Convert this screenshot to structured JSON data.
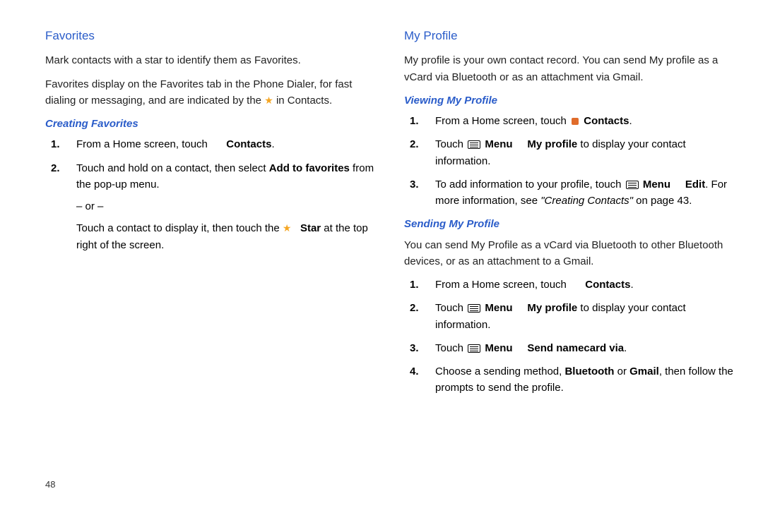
{
  "pageNumber": "48",
  "left": {
    "h1": "Favorites",
    "p1": "Mark contacts with a star to identify them as Favorites.",
    "p2a": "Favorites display on the Favorites tab in the Phone Dialer, for fast dialing or messaging, and are indicated by the ",
    "p2b": " in Contacts.",
    "h2": "Creating Favorites",
    "s1_num": "1.",
    "s1_a": "From a Home screen, touch ",
    "s1_b": "Contacts",
    "s1_c": ".",
    "s2_num": "2.",
    "s2_a": "Touch and hold on a contact, then select ",
    "s2_b": "Add to favorites",
    "s2_c": " from the pop-up menu.",
    "s2_or": "– or –",
    "s2_d": "Touch a contact to display it, then touch the ",
    "s2_e": "Star",
    "s2_f": " at the top right of the screen."
  },
  "right": {
    "h1": "My Profile",
    "p1": "My profile is your own contact record. You can send My profile as a vCard via Bluetooth or as an attachment via Gmail.",
    "h2a": "Viewing My Profile",
    "a1_num": "1.",
    "a1_a": "From a Home screen, touch ",
    "a1_b": "Contacts",
    "a1_c": ".",
    "a2_num": "2.",
    "a2_a": "Touch ",
    "a2_b": "Menu",
    "a2_arrow": " ",
    "a2_c": "My profile",
    "a2_d": " to display your contact information.",
    "a3_num": "3.",
    "a3_a": "To add information to your profile, touch ",
    "a3_b": "Menu",
    "a3_c": "Edit",
    "a3_d": ". For more information, see ",
    "a3_e": "\"Creating Contacts\"",
    "a3_f": " on page 43.",
    "h2b": "Sending My Profile",
    "p2": "You can send My Profile as a vCard via Bluetooth to other Bluetooth devices, or as an attachment to a Gmail.",
    "b1_num": "1.",
    "b1_a": "From a Home screen, touch ",
    "b1_b": "Contacts",
    "b1_c": ".",
    "b2_num": "2.",
    "b2_a": "Touch ",
    "b2_b": "Menu",
    "b2_c": "My profile",
    "b2_d": " to display your contact information.",
    "b3_num": "3.",
    "b3_a": "Touch ",
    "b3_b": "Menu",
    "b3_c": "Send namecard via",
    "b3_d": ".",
    "b4_num": "4.",
    "b4_a": "Choose a sending method, ",
    "b4_b": "Bluetooth",
    "b4_c": " or ",
    "b4_d": "Gmail",
    "b4_e": ", then follow the prompts to send the profile."
  }
}
